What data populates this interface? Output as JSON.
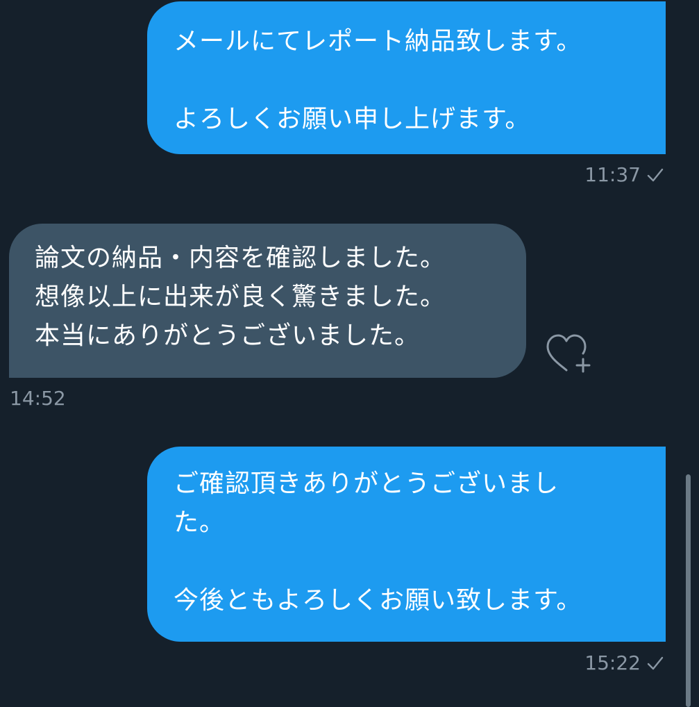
{
  "colors": {
    "background": "#15202b",
    "sent_bubble": "#1d9bf0",
    "received_bubble": "#3d5466",
    "meta_text": "#8b98a5"
  },
  "messages": [
    {
      "direction": "sent",
      "text": "メールにてレポート納品致します。\n\nよろしくお願い申し上げます。",
      "time": "11:37",
      "status_icon": "check-icon"
    },
    {
      "direction": "received",
      "text": "論文の納品・内容を確認しました。\n想像以上に出来が良く驚きました。\n本当にありがとうございました。",
      "time": "14:52",
      "reaction_icon": "heart-add-icon"
    },
    {
      "direction": "sent",
      "text": "ご確認頂きありがとうございまし\nた。\n\n今後ともよろしくお願い致します。",
      "time": "15:22",
      "status_icon": "check-icon"
    }
  ]
}
